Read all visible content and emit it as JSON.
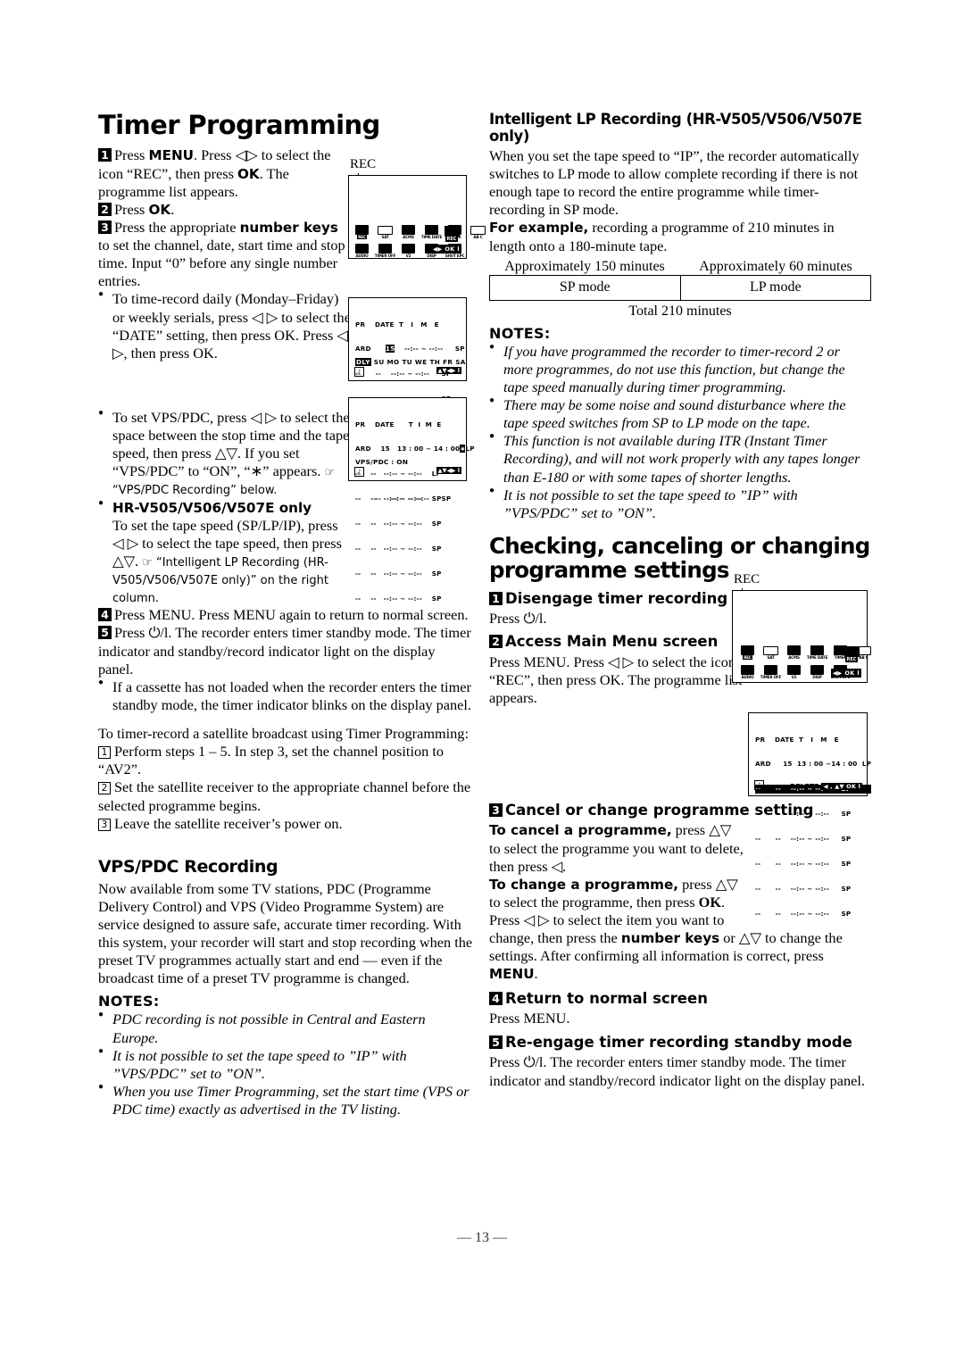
{
  "page": {
    "number": "— 13 —"
  },
  "left": {
    "title": "Timer Programming",
    "step1": {
      "num": "1",
      "text_a": "Press ",
      "menu": "MENU",
      "text_b": ". Press ",
      "arrows": "◁▷",
      "text_c": " to select the icon “REC”, then press ",
      "ok": "OK",
      "text_d": ". The programme list appears."
    },
    "step2": {
      "num": "2",
      "text_a": "Press ",
      "ok": "OK",
      "text_b": "."
    },
    "step3": {
      "num": "3",
      "text_a": "Press the appropriate ",
      "bold": "number keys",
      "text_b": " to set the channel, date, start time and stop time. Input “0” before any single number entries."
    },
    "bullet_daily": "To time-record daily (Monday–Friday) or weekly serials, press ◁ ▷ to select the “DATE” setting, then press OK. Press ◁ ▷, then press OK.",
    "bullet_vpspdc": "To set VPS/PDC, press ◁ ▷ to select the space between the stop time and the tape speed, then press △▽. If you set “VPS/PDC” to “ON”, “∗” appears.",
    "ref_vpspdc": "☞ “VPS/PDC Recording” below.",
    "bullet_models": "HR-V505/V506/V507E only",
    "models_body": "To set the tape speed (SP/LP/IP), press ◁ ▷ to select the tape speed, then press △▽.",
    "ref_ilp": "☞ “Intelligent LP Recording (HR-V505/V506/V507E only)” on the right column.",
    "step4": {
      "num": "4",
      "text": "Press MENU. Press MENU again to return to normal screen."
    },
    "step5": {
      "num": "5",
      "text": "Press ⏻/l. The recorder enters timer standby mode. The timer indicator and standby/record indicator light on the display panel."
    },
    "bullet_cassette": "If a cassette has not loaded when the recorder enters the timer standby mode, the timer indicator blinks on the display panel.",
    "satellite_intro": "To timer-record a satellite broadcast using Timer Programming:",
    "sat1": {
      "num": "1",
      "text": "Perform steps 1 – 5. In step 3, set the channel position to “AV2”."
    },
    "sat2": {
      "num": "2",
      "text": "Set the satellite receiver to the appropriate channel before the selected programme begins."
    },
    "sat3": {
      "num": "3",
      "text": "Leave the satellite receiver’s power on."
    },
    "vpspdc_title": "VPS/PDC Recording",
    "vpspdc_body": "Now available from some TV stations, PDC (Programme Delivery Control) and VPS (Video Programme System) are service designed to assure safe, accurate timer recording. With this system, your recorder will start and stop recording when the preset TV programmes actually start and end — even if the broadcast time of a preset TV programme is changed.",
    "notes_label": "NOTES:",
    "notes": [
      "PDC recording is not possible in Central and Eastern Europe.",
      "It is not possible to set the tape speed to ”IP” with ”VPS/PDC” set to ”ON”.",
      "When you use Timer Programming, set the start time (VPS or PDC time) exactly as advertised in the TV listing."
    ]
  },
  "right": {
    "ilp_title": "Intelligent LP Recording (HR-V505/V506/V507E only)",
    "ilp_body": "When you set the tape speed to “IP”, the recorder automatically switches to LP mode to allow complete recording if there is not enough tape to record the entire programme while timer-recording in SP mode.",
    "example_bold": "For example,",
    "example_rest": " recording a programme of 210 minutes in length onto a 180-minute tape.",
    "lp_table": {
      "caption_left": "Approximately 150 minutes",
      "caption_right": "Approximately 60 minutes",
      "cell_left": "SP mode",
      "cell_right": "LP mode",
      "total": "Total 210 minutes"
    },
    "notes_label": "NOTES:",
    "notes": [
      "If you have programmed the recorder to timer-record 2 or more programmes, do not use this function, but change the tape speed manually during timer programming.",
      "There may be some noise and sound disturbance where the tape speed switches from SP to LP mode on the tape.",
      "This function is not available during ITR (Instant Timer Recording), and will not work properly with any tapes longer than E-180 or with some tapes of shorter lengths.",
      "It is not possible to set the tape speed to ”IP” with ”VPS/PDC” set to ”ON”."
    ],
    "checking_title": "Checking, canceling or changing programme settings",
    "c1": {
      "num": "1",
      "head": "Disengage timer recording standby mode",
      "body": "Press ⏻/l."
    },
    "c2": {
      "num": "2",
      "head": "Access Main Menu screen",
      "body": "Press MENU. Press ◁ ▷ to select the icon “REC”, then press OK. The programme list appears."
    },
    "c3": {
      "num": "3",
      "head": "Cancel or change programme setting",
      "cancel_bold": "To cancel a programme,",
      "cancel_rest": " press △▽ to select the programme you want to delete, then press ◁.",
      "change_bold": "To change a programme,",
      "change_rest": " press △▽ to select the programme, then press OK. Press ◁ ▷ to select the item you want to change, then press the number keys or △▽ to change the settings. After confirming all information is correct, press MENU."
    },
    "c4": {
      "num": "4",
      "head": "Return to normal screen",
      "body": "Press MENU."
    },
    "c5": {
      "num": "5",
      "head": "Re-engage timer recording standby mode",
      "body": "Press ⏻/l. The recorder enters timer standby mode. The timer indicator and standby/record indicator light on the display panel."
    }
  },
  "screens": {
    "menu_screen_1": {
      "rec_label": "REC",
      "icons_row1": [
        "REC",
        "SAT",
        "ACMS",
        "TIME DATE",
        "TIMER",
        "AB C"
      ],
      "icons_row2": [
        "AUDIO",
        "TIMER OFF",
        "V2",
        "DISP",
        "SHUT EPC"
      ],
      "badge": "REC",
      "okbar": "◀▶ OK l"
    },
    "menu_screen_2": {
      "rec_label": "REC",
      "badge": "REC",
      "okbar": "◀▶ OK l"
    },
    "proglist_1": {
      "headers": "PR    DATE  T   I   M   E",
      "row1_pr": "ARD",
      "row1_date": "15",
      "row1_time": "--:-- ~ --:--",
      "row1_speed": "SP",
      "empty_pr": "--",
      "empty_date": "--",
      "empty_time": "--:-- ~ --:--",
      "empty_speed": "SP",
      "daysrow": [
        "DLY",
        "SU",
        "MO",
        "TU",
        "WE",
        "TH",
        "FR",
        "SA"
      ],
      "nav": "▲▼◀▶ l"
    },
    "proglist_2": {
      "headers": "PR    DATE      T  I  M  E",
      "row1_pr": "ARD",
      "row1_date": "15",
      "row1_time": "13 : 00 ~ 14 : 00",
      "row1_mark": "∗",
      "row1_speed": "LP",
      "row2_speed": "LP",
      "empty_pr": "--",
      "empty_date": "--",
      "empty_time": "--:-- ~ --:--",
      "empty_speed": "SP",
      "vpspdc": "VPS/PDC : ON",
      "nav": "▲▼◀▶ l"
    },
    "proglist_3": {
      "headers": "PR    DATE  T   I   M   E",
      "row1_pr": "ARD",
      "row1_date": "15",
      "row1_time": "13 : 00 ~14 : 00",
      "row1_speed": "LP",
      "sel_pr": "--",
      "sel_date": "--",
      "sel_time": "--:-- ~ --:--",
      "sel_speed": "SP",
      "empty_pr": "--",
      "empty_date": "--",
      "empty_time": "--:-- ~ --:--",
      "empty_speed": "SP",
      "delete_label": "DELETE:",
      "delete_nav": "◀ , ▲▼ OK l"
    }
  }
}
